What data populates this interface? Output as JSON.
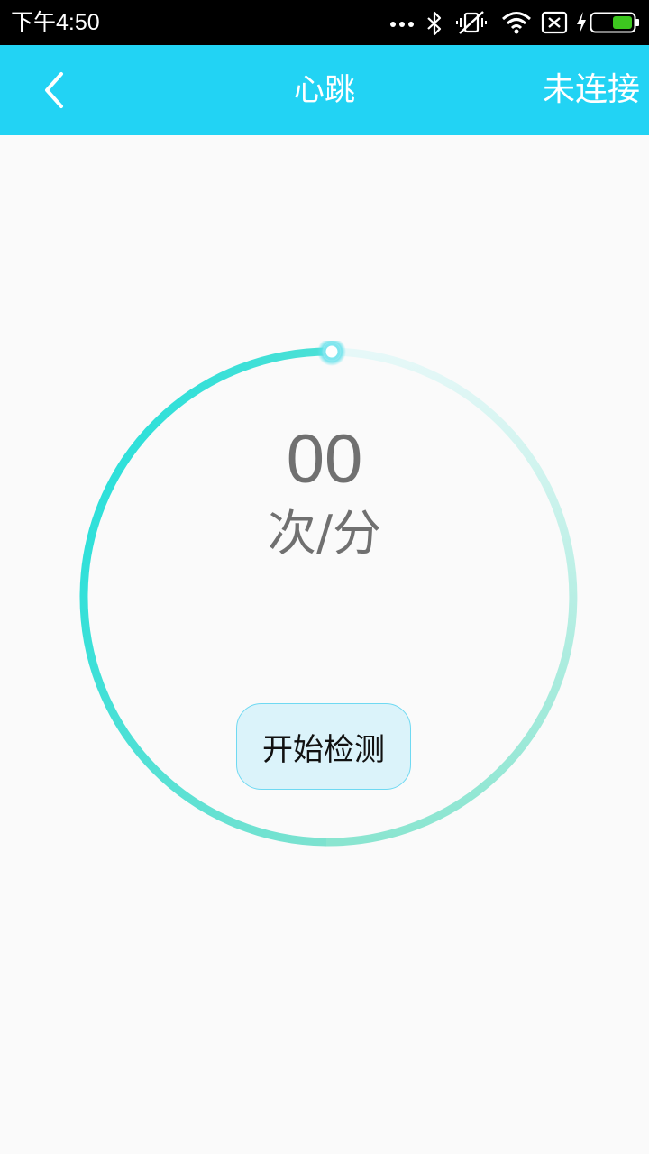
{
  "status_bar": {
    "time": "下午4:50",
    "icons": [
      "more-dots-icon",
      "bluetooth-icon",
      "vibrate-off-icon",
      "wifi-icon",
      "no-sim-icon",
      "charging-icon",
      "battery-icon"
    ]
  },
  "header": {
    "back_icon": "chevron-left-icon",
    "title": "心跳",
    "connection_status": "未连接"
  },
  "monitor": {
    "bpm_value": "00",
    "bpm_unit": "次/分",
    "start_button_label": "开始检测"
  },
  "colors": {
    "header_bg": "#22d3f4",
    "page_bg": "#fafafa",
    "ring_start": "#1cdfdc",
    "button_bg": "#dbf3fa",
    "button_border": "#6fd9f2",
    "text_gray": "#707070"
  }
}
